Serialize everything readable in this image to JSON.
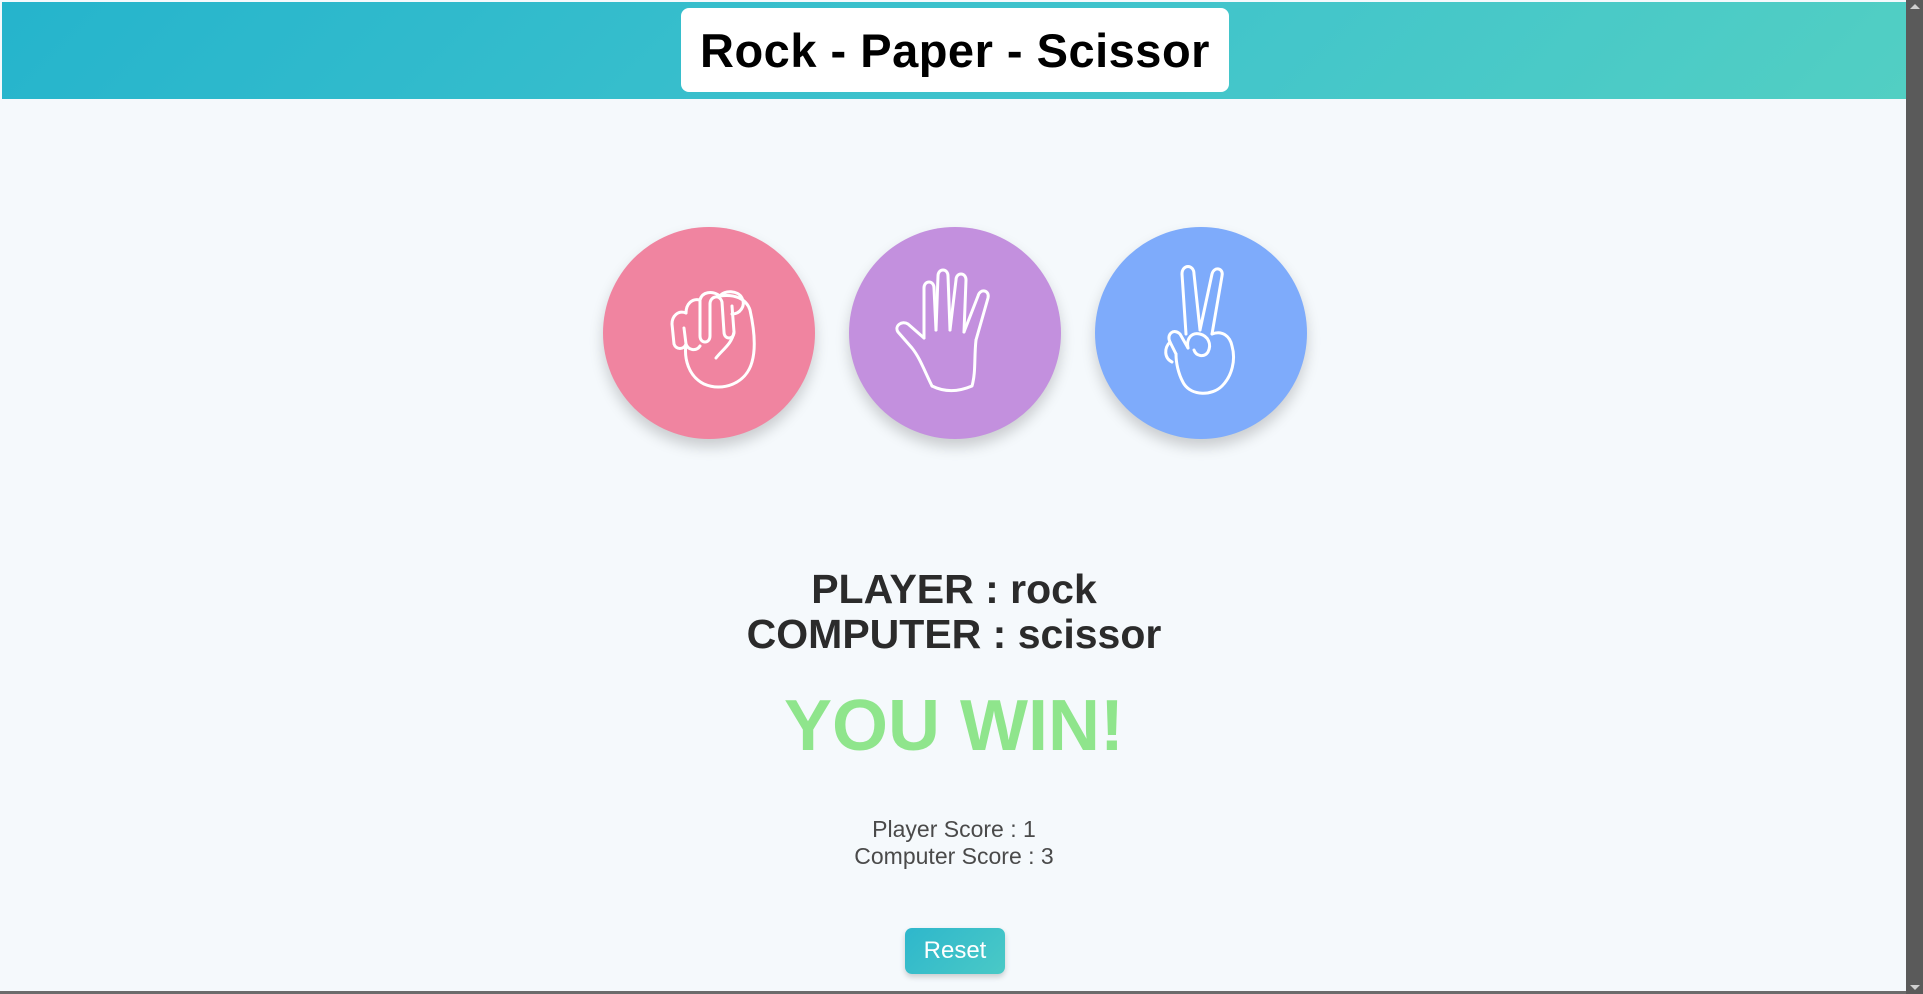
{
  "header": {
    "title": "Rock - Paper - Scissor"
  },
  "choices": [
    {
      "id": "rock",
      "icon": "fist-icon",
      "color": "#f084a0"
    },
    {
      "id": "paper",
      "icon": "open-hand-icon",
      "color": "#c390de"
    },
    {
      "id": "scissor",
      "icon": "peace-hand-icon",
      "color": "#7eabfb"
    }
  ],
  "result": {
    "player_line": "PLAYER : rock",
    "computer_line": "COMPUTER : scissor",
    "outcome": "YOU WIN!",
    "outcome_color": "#8fe58c"
  },
  "scores": {
    "player": "Player Score : 1",
    "computer": "Computer Score : 3"
  },
  "controls": {
    "reset_label": "Reset"
  },
  "colors": {
    "header_gradient_start": "#25b4cc",
    "header_gradient_end": "#52cfc3",
    "page_background": "#f5f9fc"
  }
}
